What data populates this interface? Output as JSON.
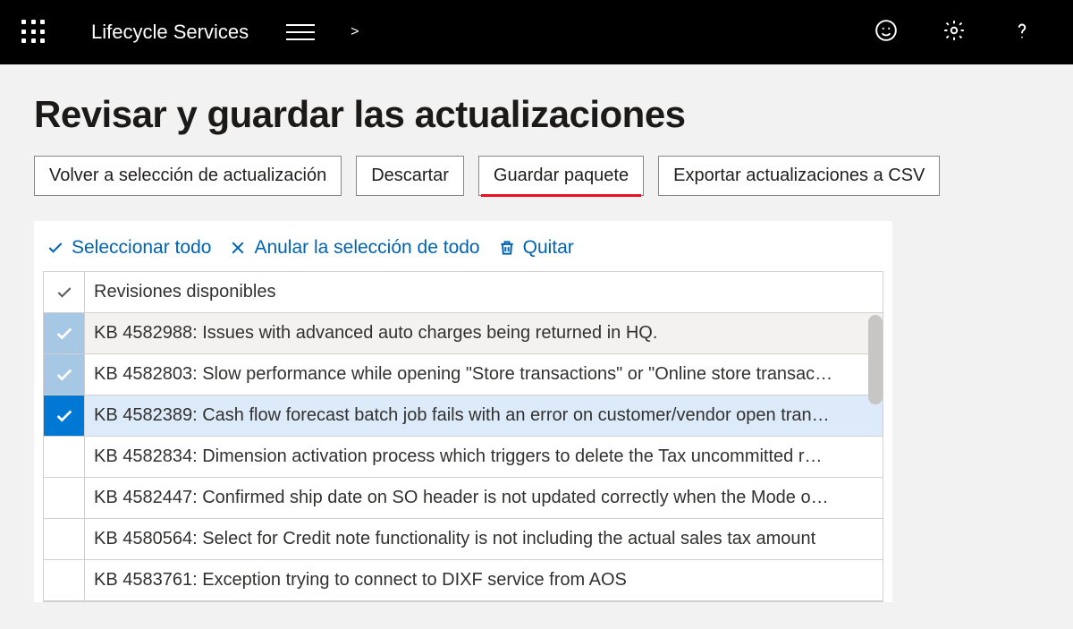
{
  "topbar": {
    "app_title": "Lifecycle Services",
    "breadcrumb_caret": ">"
  },
  "page": {
    "title": "Revisar y guardar las actualizaciones"
  },
  "buttons": {
    "back": "Volver a selección de actualización",
    "discard": "Descartar",
    "save": "Guardar paquete",
    "export": "Exportar actualizaciones a CSV"
  },
  "commands": {
    "select_all": "Seleccionar todo",
    "deselect_all": "Anular la selección de todo",
    "remove": "Quitar"
  },
  "table": {
    "header": "Revisiones disponibles",
    "rows": [
      {
        "selected": "light",
        "stripe": true,
        "text": "KB 4582988: Issues with advanced auto charges being returned in HQ."
      },
      {
        "selected": "light",
        "stripe": false,
        "text": "KB 4582803: Slow performance while opening \"Store transactions\" or \"Online store transac…"
      },
      {
        "selected": "dark",
        "stripe": false,
        "text": "KB 4582389: Cash flow forecast batch job fails with an error on customer/vendor open tran…"
      },
      {
        "selected": "none",
        "stripe": false,
        "text": "KB 4582834: Dimension activation process which triggers to delete the Tax uncommitted r…"
      },
      {
        "selected": "none",
        "stripe": false,
        "text": "KB 4582447: Confirmed ship date on SO header is not updated correctly when the Mode o…"
      },
      {
        "selected": "none",
        "stripe": false,
        "text": "KB 4580564: Select for Credit note functionality is not including the actual sales tax amount"
      },
      {
        "selected": "none",
        "stripe": false,
        "text": "KB 4583761: Exception trying to connect to DIXF service from AOS"
      }
    ]
  }
}
